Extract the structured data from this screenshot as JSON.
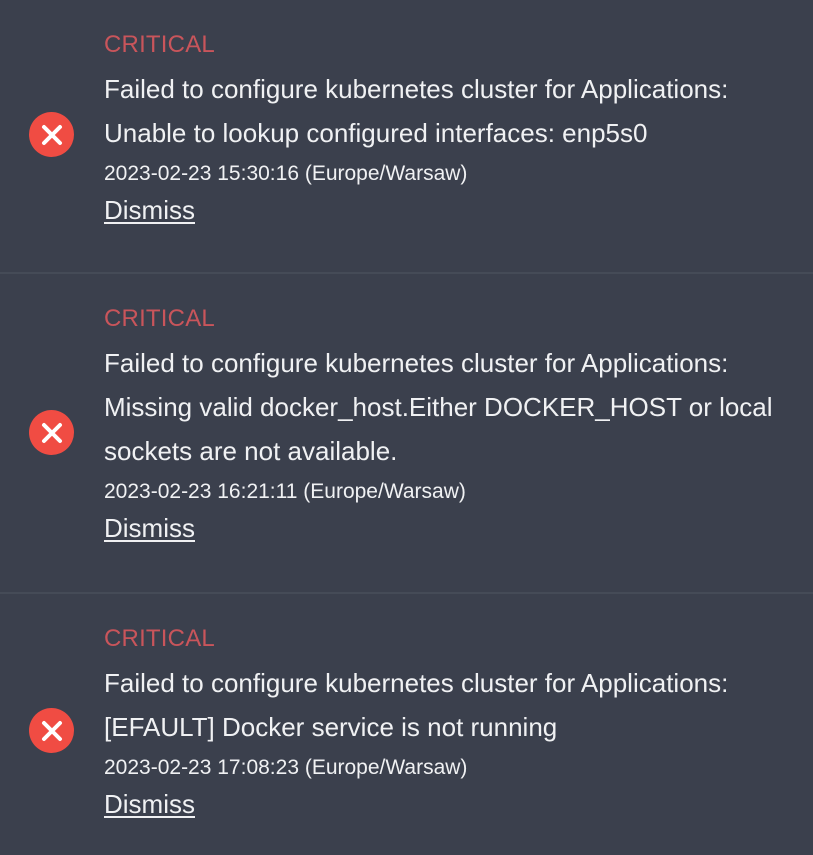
{
  "alerts": [
    {
      "level": "CRITICAL",
      "message": "Failed to configure kubernetes cluster for Applications: Unable to lookup configured interfaces: enp5s0",
      "datetime": "2023-02-23 15:30:16 (Europe/Warsaw)",
      "dismiss_label": "Dismiss"
    },
    {
      "level": "CRITICAL",
      "message": "Failed to configure kubernetes cluster for Applications: Missing valid docker_host.Either DOCKER_HOST or local sockets are not available.",
      "datetime": "2023-02-23 16:21:11 (Europe/Warsaw)",
      "dismiss_label": "Dismiss"
    },
    {
      "level": "CRITICAL",
      "message": "Failed to configure kubernetes cluster for Applications: [EFAULT] Docker service is not running",
      "datetime": "2023-02-23 17:08:23 (Europe/Warsaw)",
      "dismiss_label": "Dismiss"
    }
  ],
  "colors": {
    "background": "#3b404d",
    "critical_text": "#c9555b",
    "error_icon": "#f04c43",
    "text": "#f0f1f3"
  },
  "icons": {
    "alert_icon": "close-circle-icon"
  }
}
